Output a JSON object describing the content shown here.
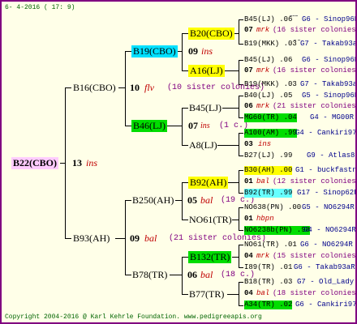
{
  "header": {
    "date": "6- 4-2016 ( 17: 9)"
  },
  "footer": {
    "copyright": "Copyright 2004-2016 @ Karl Kehrle Foundation.   www.pedigreeapis.org"
  },
  "colors": {
    "border": "#800080",
    "background": "#ffffe8",
    "highlight_magenta": "#ffccff",
    "highlight_cyan": "#00e0ff",
    "highlight_yellow": "#ffff00",
    "highlight_green": "#00dd00",
    "highlight_cyan_light": "#66ffff"
  },
  "root": {
    "label": "B22(CBO)",
    "year": "13",
    "suffix": "ins"
  },
  "gen1": {
    "top": {
      "label": "B16(CBO)",
      "year": "10",
      "suffix": "flv",
      "note": "(10 sister colonies)"
    },
    "bottom": {
      "label": "B93(AH)",
      "year": "09",
      "suffix": "bal",
      "note": "(21 sister colonies)"
    }
  },
  "gen2": {
    "a": {
      "label": "B19(CBO)"
    },
    "b": {
      "label": "B46(LJ)"
    },
    "c": {
      "label": "B250(AH)",
      "year": "05",
      "suffix": "bal",
      "note": "(19 c.)"
    },
    "d": {
      "label": "B78(TR)",
      "year": "06",
      "suffix": "bal",
      "note": "(18 c.)"
    }
  },
  "gen3": {
    "a1": {
      "label": "B20(CBO)",
      "year": "09",
      "suffix": "ins"
    },
    "a2": {
      "label": "A16(LJ)"
    },
    "b1": {
      "label": "B45(LJ)",
      "year": "07",
      "suffix": "ins",
      "note": "(1 c.)"
    },
    "b2": {
      "label": "A8(LJ)"
    },
    "c1": {
      "label": "B92(AH)",
      "year": "01",
      "suffix": "bal"
    },
    "c2": {
      "label": "NO61(TR)"
    },
    "d1": {
      "label": "B132(TR)",
      "year": "04",
      "suffix": "mrk"
    },
    "d2": {
      "label": "B77(TR)"
    }
  },
  "gen4": {
    "a1a": "B45(LJ) .06",
    "a1a_r": "G6 - Sinop96R",
    "a1y": "07",
    "a1s": "mrk",
    "a1n": "(16 sister colonies)",
    "a1b": "B19(MKK) .03",
    "a1b_r": "G7 - Takab93aR",
    "a2a": "B45(LJ) .06",
    "a2a_r": "G6 - Sinop96R",
    "a2y": "07",
    "a2s": "mrk",
    "a2n": "(16 sister colonies)",
    "a2b": "B19(MKK) .03",
    "a2b_r": "G7 - Takab93aR",
    "b1a": "B40(LJ) .05",
    "b1a_r": "G5 - Sinop96R",
    "b1y": "06",
    "b1s": "mrk",
    "b1n": "(21 sister colonies)",
    "b1b": "MG60(TR) .04",
    "b1b_r": "G4 - MG00R",
    "b2a": "A100(AM) .99",
    "b2a_r": "G4 - Cankiri97Q",
    "b2y": "03",
    "b2s": "ins",
    "b2b": "B27(LJ) .99",
    "b2b_r": "G9 - Atlas85R",
    "c1a": "B30(AH) .00",
    "c1a_r": "G1 - buckfastno",
    "c1y": "01",
    "c1s": "bal",
    "c1n": "(12 sister colonies)",
    "c1b": "B92(TR) .99",
    "c1b_r": "G17 - Sinop62R",
    "c2a": "NO638(PN) .00",
    "c2a_r": "G5 - NO6294R",
    "c2y": "01",
    "c2s": "hbpn",
    "c2b": "NO6238b(PN) .98",
    "c2b_r": "G4 - NO6294R",
    "d1a": "NO61(TR) .01",
    "d1a_r": "G6 - NO6294R",
    "d1y": "04",
    "d1s": "mrk",
    "d1n": "(15 sister colonies)",
    "d1b": "I89(TR) .01",
    "d1b_r": "G6 - Takab93aR",
    "d2a": "B18(TR) .03",
    "d2a_r": "G7 - Old_Lady",
    "d2y": "04",
    "d2s": "bal",
    "d2n": "(18 sister colonies)",
    "d2b": "A34(TR) .02",
    "d2b_r": "G6 - Cankiri97Q"
  }
}
